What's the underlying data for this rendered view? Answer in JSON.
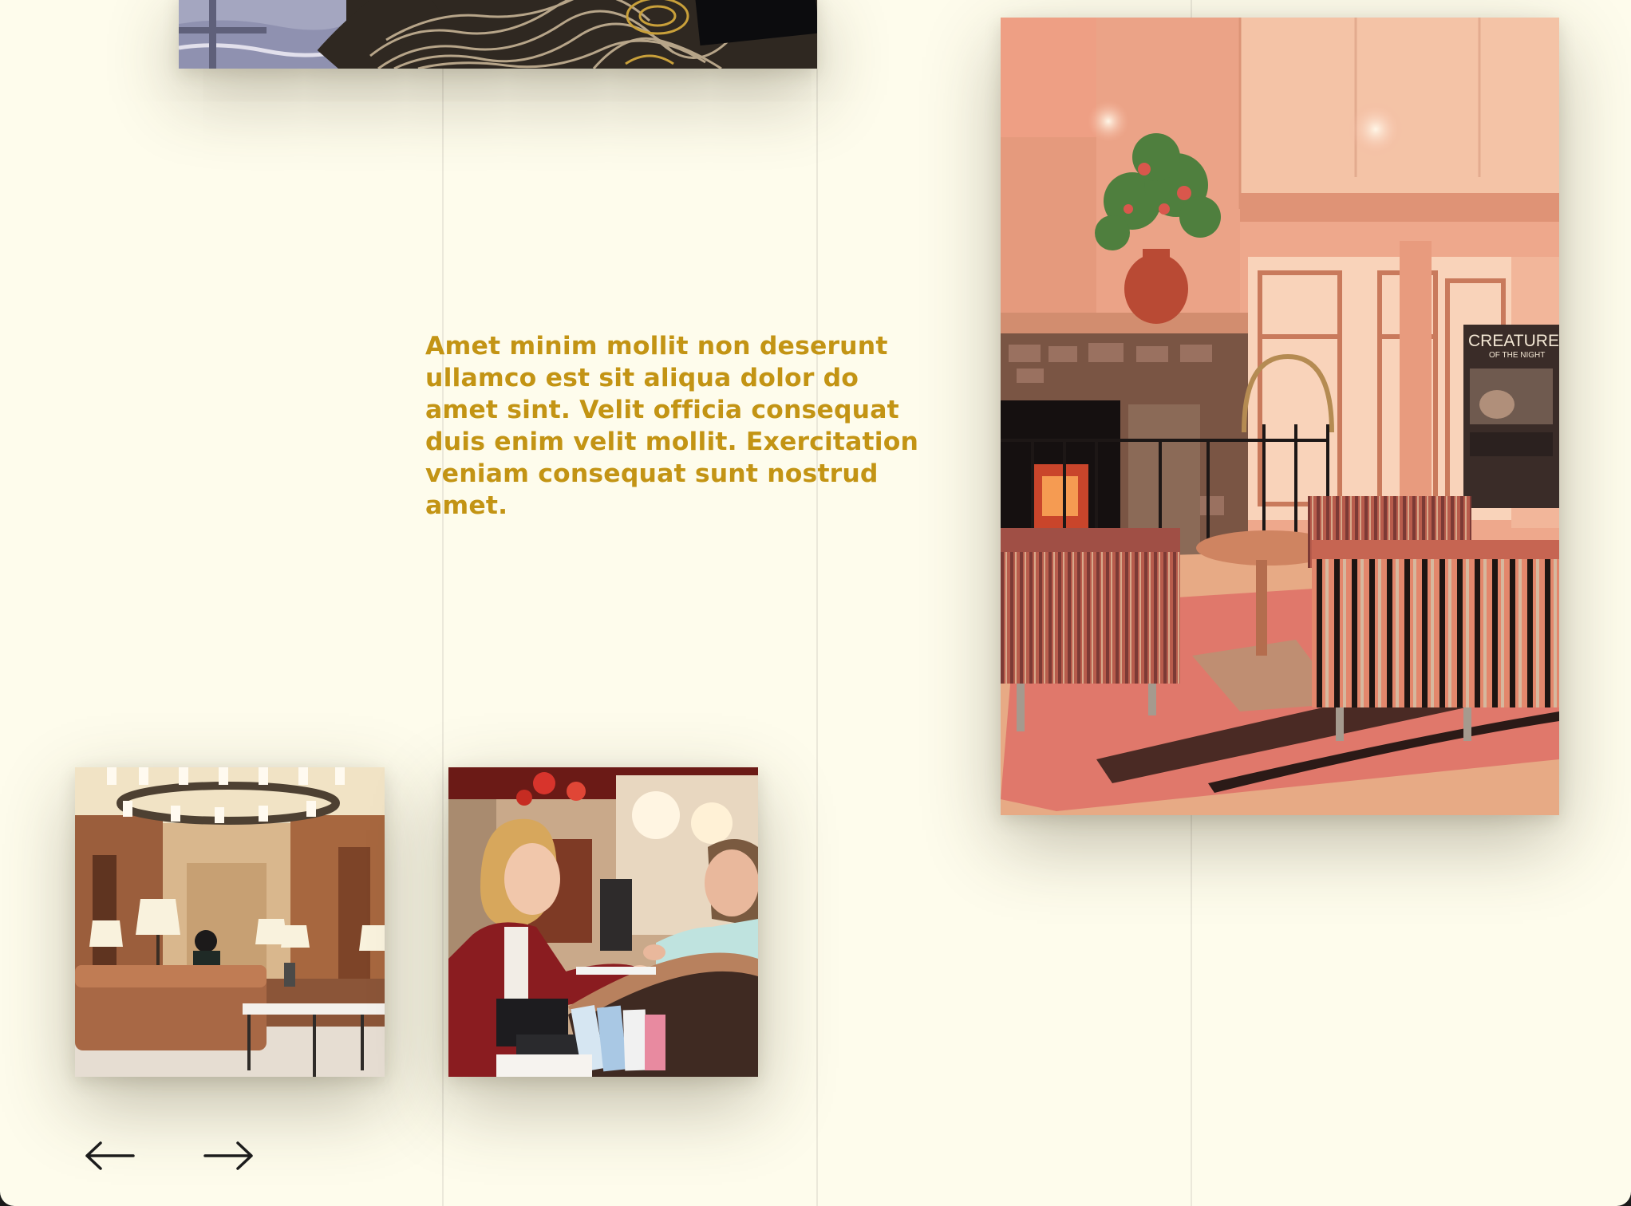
{
  "page": {
    "tagline": "Amet minim mollit non deserunt ullamco est sit aliqua dolor do amet sint. Velit officia consequat duis enim velit mollit. Exercitation veniam consequat sunt nostrud amet."
  },
  "images": {
    "carpet": "photo-carpet-detail",
    "lobby_fireplace": "photo-lobby-fireplace",
    "lounge": "photo-hotel-lounge",
    "reception": "photo-reception-desk"
  },
  "lobby_poster": {
    "title": "CREATURES",
    "subtitle": "OF THE NIGHT"
  },
  "navigation": {
    "prev_icon": "arrow-left-icon",
    "next_icon": "arrow-right-icon"
  },
  "colors": {
    "background": "#fefcec",
    "accent_text": "#c39414",
    "gridline": "#ebe8da",
    "arrow": "#1c1c1c"
  }
}
